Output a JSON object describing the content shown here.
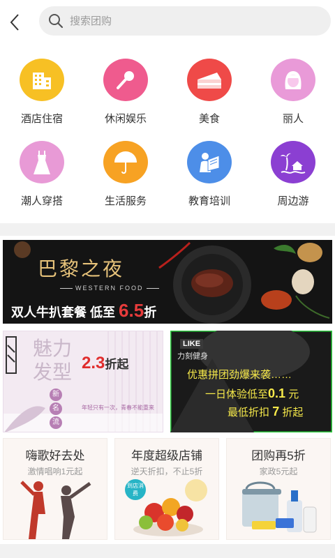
{
  "search": {
    "placeholder": "搜索团购"
  },
  "categories": [
    {
      "label": "酒店住宿",
      "icon": "hotel-building-icon",
      "color": "#f7c024"
    },
    {
      "label": "休闲娱乐",
      "icon": "microphone-icon",
      "color": "#ef5b8e"
    },
    {
      "label": "美食",
      "icon": "cake-icon",
      "color": "#ef4a48"
    },
    {
      "label": "丽人",
      "icon": "woman-face-icon",
      "color": "#e99ad8"
    },
    {
      "label": "潮人穿搭",
      "icon": "dress-icon",
      "color": "#e89ad6"
    },
    {
      "label": "生活服务",
      "icon": "umbrella-icon",
      "color": "#f7a223"
    },
    {
      "label": "教育培训",
      "icon": "reading-person-icon",
      "color": "#4d8ee8"
    },
    {
      "label": "周边游",
      "icon": "palm-island-icon",
      "color": "#8b3fd2"
    }
  ],
  "banner_paris": {
    "title": "巴黎之夜",
    "subtitle": "WESTERN FOOD",
    "line_prefix": "双人牛扒套餐 低至",
    "line_value": "6.5",
    "line_suffix": "折"
  },
  "banner_hair": {
    "big_top": "魅力",
    "big_bottom": "发型",
    "discount": "2.3",
    "discount_suffix": "折起",
    "badges": [
      "新",
      "名",
      "流"
    ],
    "note": "年轻只有一次，青春不能重来"
  },
  "banner_fitness": {
    "tag": "LIKE",
    "brand": "力刻健身",
    "line1": "优惠拼团劲爆来袭……",
    "line2_prefix": "一日体验低至",
    "line2_value": "0.1",
    "line2_suffix": "元",
    "line3_prefix": "最低折扣",
    "line3_value": "7",
    "line3_suffix": "折起"
  },
  "cards": [
    {
      "title": "嗨歌好去处",
      "subtitle": "激情唱响1元起"
    },
    {
      "title": "年度超级店铺",
      "subtitle": "逆天折扣，不止5折",
      "badge": "到店消费"
    },
    {
      "title": "团购再5折",
      "subtitle": "家政5元起"
    }
  ]
}
